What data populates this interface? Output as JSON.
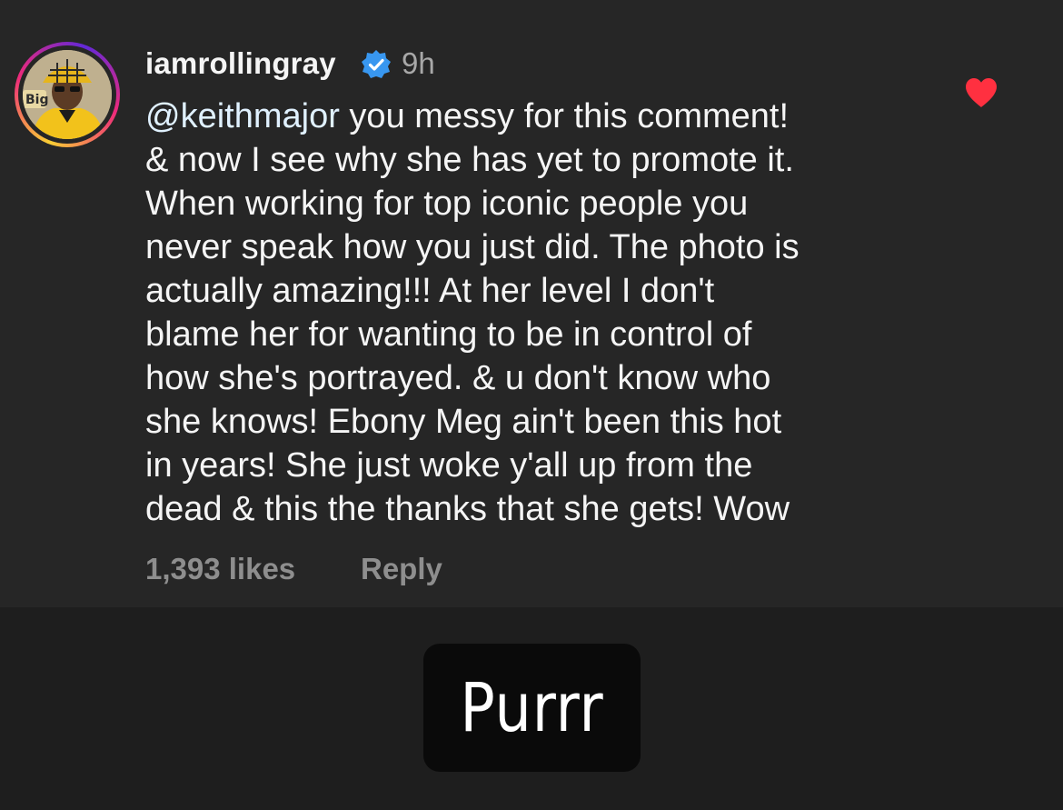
{
  "comment": {
    "username": "iamrollingray",
    "verified_icon": "verified-badge-icon",
    "timestamp": "9h",
    "liked": true,
    "like_icon": "heart-filled-icon",
    "mention": "@keithmajor",
    "text_lines": [
      " you messy for this comment!",
      "& now I see why she has yet to promote it.",
      "When working for top iconic people you",
      "never speak how you just did. The photo is",
      "actually amazing!!! At her level I don't",
      "blame her for wanting to be in control of",
      "how she's portrayed. & u don't know who",
      "she knows! Ebony Meg ain't been this hot",
      "in years! She just woke y'all up from the",
      "dead & this the thanks that she gets! Wow"
    ],
    "likes_label": "1,393 likes",
    "reply_label": "Reply",
    "avatar_text": "Big"
  },
  "sticker": {
    "text": "Purrr"
  },
  "colors": {
    "background": "#262626",
    "lower_background": "#1e1e1e",
    "text": "#f5f5f5",
    "mention": "#e0f1ff",
    "muted": "#8e8e8e",
    "heart": "#ff3040",
    "verified": "#3897f0"
  }
}
